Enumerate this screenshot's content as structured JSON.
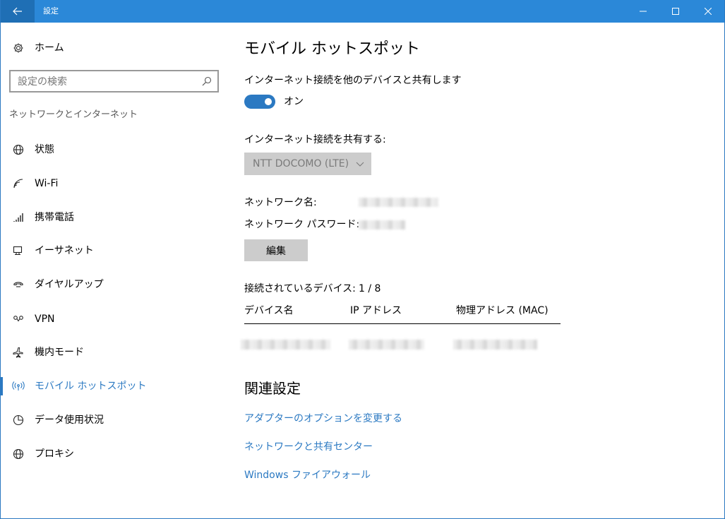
{
  "window": {
    "title": "設定"
  },
  "sidebar": {
    "home_label": "ホーム",
    "search_placeholder": "設定の検索",
    "section_label": "ネットワークとインターネット",
    "items": [
      {
        "label": "状態",
        "icon": "globe-icon"
      },
      {
        "label": "Wi-Fi",
        "icon": "wifi-icon"
      },
      {
        "label": "携帯電話",
        "icon": "signal-bars-icon"
      },
      {
        "label": "イーサネット",
        "icon": "ethernet-icon"
      },
      {
        "label": "ダイヤルアップ",
        "icon": "dialup-icon"
      },
      {
        "label": "VPN",
        "icon": "vpn-icon"
      },
      {
        "label": "機内モード",
        "icon": "airplane-icon"
      },
      {
        "label": "モバイル ホットスポット",
        "icon": "hotspot-icon",
        "active": true
      },
      {
        "label": "データ使用状況",
        "icon": "pie-chart-icon"
      },
      {
        "label": "プロキシ",
        "icon": "globe-icon"
      }
    ]
  },
  "main": {
    "title": "モバイル ホットスポット",
    "share_label": "インターネット接続を他のデバイスと共有します",
    "toggle_state": "オン",
    "share_from_label": "インターネット接続を共有する:",
    "share_from_value": "NTT DOCOMO (LTE)",
    "network_name_label": "ネットワーク名:",
    "network_password_label": "ネットワーク パスワード:",
    "edit_label": "編集",
    "connected_devices_label": "接続されているデバイス:",
    "connected_devices_count": "1 / 8",
    "table_headers": [
      "デバイス名",
      "IP アドレス",
      "物理アドレス (MAC)"
    ],
    "related_title": "関連設定",
    "links": [
      "アダプターのオプションを変更する",
      "ネットワークと共有センター",
      "Windows ファイアウォール"
    ]
  },
  "colors": {
    "accent": "#2b79c2",
    "titlebar": "#2b88d8"
  }
}
